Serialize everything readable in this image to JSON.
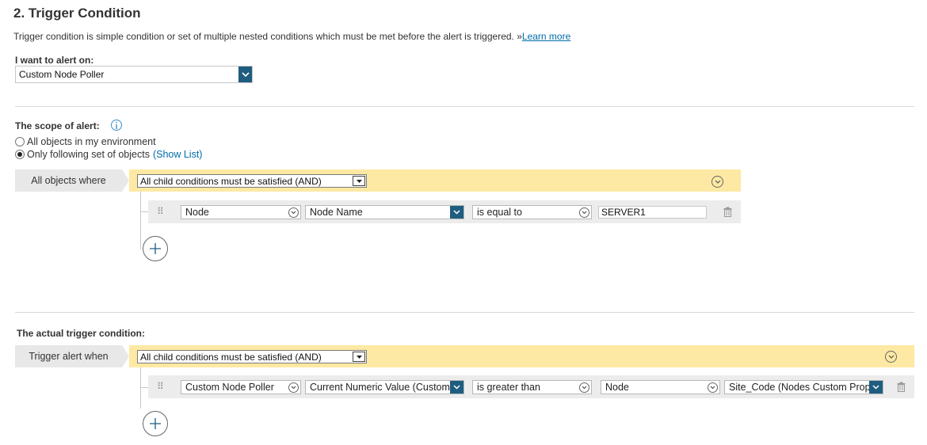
{
  "section": {
    "title": "2. Trigger Condition",
    "description": "Trigger condition is simple condition or set of multiple nested conditions which must be met before the alert is triggered.",
    "learn_more_prefix": "»",
    "learn_more": "Learn more"
  },
  "alert_on": {
    "label": "I want to alert on:",
    "value": "Custom Node Poller"
  },
  "scope": {
    "label": "The scope of alert:",
    "options": [
      "All objects in my environment",
      "Only following set of objects"
    ],
    "selected_index": 1,
    "show_list": "(Show List)",
    "group_tag": "All objects where",
    "group_operator": "All child conditions must be satisfied (AND)",
    "condition": {
      "object": "Node",
      "field": "Node Name",
      "operator": "is equal to",
      "value": "SERVER1"
    }
  },
  "trigger": {
    "label": "The actual trigger condition:",
    "group_tag": "Trigger alert when",
    "group_operator": "All child conditions must be satisfied (AND)",
    "condition": {
      "object": "Custom Node Poller",
      "field": "Current Numeric Value (Custom",
      "operator": "is greater than",
      "compare_object": "Node",
      "compare_field": "Site_Code (Nodes Custom Prope"
    }
  },
  "colors": {
    "accent_dark": "#1f5d80",
    "link": "#006ca9",
    "group_bar": "#fde9a3",
    "condition_row": "#ececec"
  }
}
